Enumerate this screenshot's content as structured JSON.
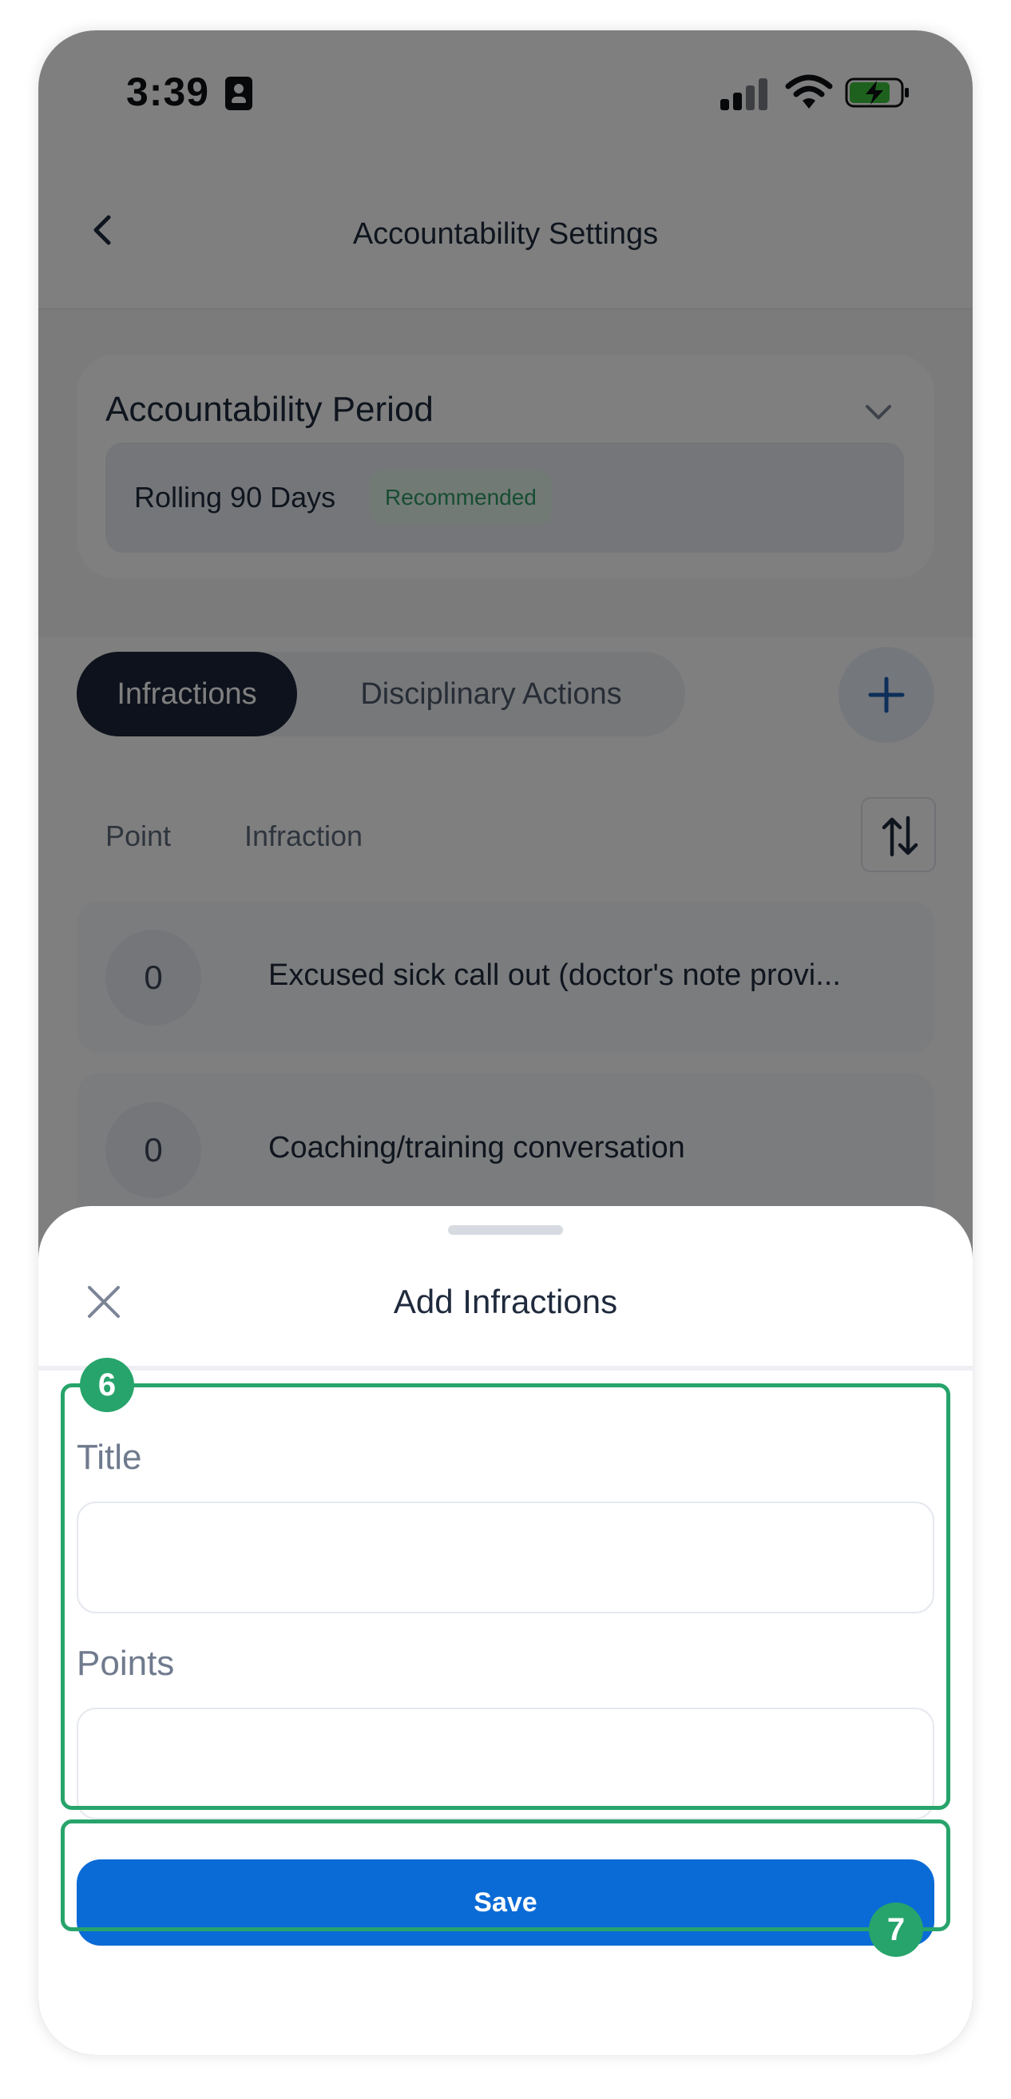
{
  "status_bar": {
    "time": "3:39"
  },
  "header": {
    "title": "Accountability Settings"
  },
  "accountability_period": {
    "heading": "Accountability Period",
    "selected_value": "Rolling 90 Days",
    "badge": "Recommended"
  },
  "tabs": [
    {
      "label": "Infractions",
      "active": true
    },
    {
      "label": "Disciplinary Actions",
      "active": false
    }
  ],
  "table": {
    "columns": [
      "Point",
      "Infraction"
    ],
    "rows": [
      {
        "points": "0",
        "infraction": "Excused sick call out (doctor's note provi..."
      },
      {
        "points": "0",
        "infraction": "Coaching/training conversation"
      }
    ]
  },
  "sheet": {
    "title": "Add Infractions",
    "fields": {
      "title_label": "Title",
      "title_value": "",
      "points_label": "Points",
      "points_value": ""
    },
    "save_label": "Save"
  },
  "annotations": {
    "fields_step": "6",
    "save_step": "7"
  },
  "colors": {
    "primary_button": "#0b6bd6",
    "active_tab": "#1b2539",
    "highlight": "#27a46b",
    "recommended": "#2e9a64"
  }
}
